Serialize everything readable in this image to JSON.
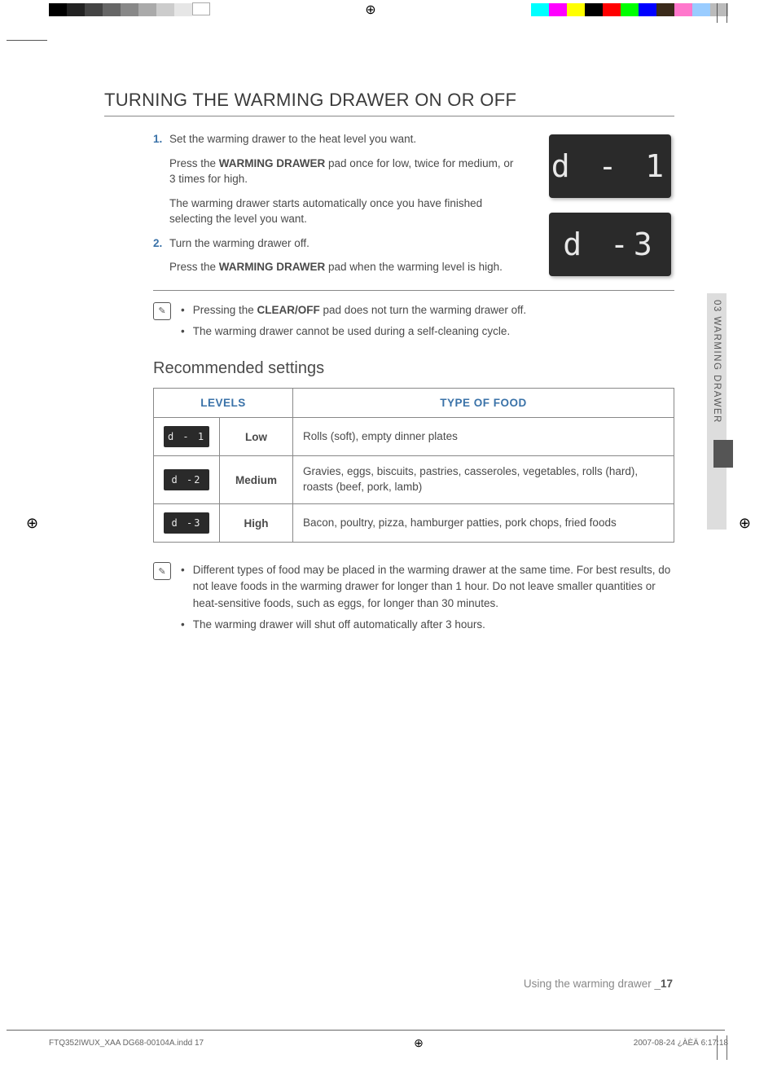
{
  "heading": "TURNING THE WARMING DRAWER ON OR OFF",
  "steps": [
    {
      "num": "1.",
      "text": "Set the warming drawer to the heat level you want.",
      "subs": [
        {
          "pre": "Press the ",
          "bold": "WARMING DRAWER",
          "post": " pad once for low, twice for medium, or 3 times for high."
        },
        {
          "plain": "The warming drawer starts automatically once you have finished selecting the level you want."
        }
      ]
    },
    {
      "num": "2.",
      "text": "Turn the warming drawer off.",
      "subs": [
        {
          "pre": "Press the ",
          "bold": "WARMING DRAWER",
          "post": " pad when the warming level is high."
        }
      ]
    }
  ],
  "displays": {
    "d1": "d - 1",
    "d3": "d -3"
  },
  "notes1": [
    {
      "pre": "Pressing the ",
      "bold": "CLEAR/OFF",
      "post": " pad does not turn the warming drawer off."
    },
    {
      "plain": "The warming drawer cannot be used during a self-cleaning cycle."
    }
  ],
  "subheading": "Recommended settings",
  "table": {
    "head": {
      "levels": "LEVELS",
      "type": "TYPE OF FOOD"
    },
    "rows": [
      {
        "disp": "d - 1",
        "level": "Low",
        "food": "Rolls (soft), empty dinner plates"
      },
      {
        "disp": "d -2",
        "level": "Medium",
        "food": "Gravies, eggs, biscuits, pastries, casseroles, vegetables, rolls (hard), roasts (beef, pork, lamb)"
      },
      {
        "disp": "d -3",
        "level": "High",
        "food": "Bacon, poultry, pizza, hamburger patties, pork chops, fried foods"
      }
    ]
  },
  "notes2": [
    {
      "plain": "Different types of food may be placed in the warming drawer at the same time. For best results, do not leave foods in the warming drawer for longer than 1 hour. Do not leave smaller quantities or heat-sensitive foods, such as eggs, for longer than 30 minutes."
    },
    {
      "plain": "The warming drawer will shut off automatically after 3 hours."
    }
  ],
  "sideTab": "03   WARMING DRAWER",
  "footer": {
    "label": "Using the warming drawer _",
    "page": "17"
  },
  "imprint": {
    "left": "FTQ352IWUX_XAA DG68-00104A.indd   17",
    "right": "2007-08-24   ¿ÀÈÄ 6:17:18"
  },
  "chart_data": {
    "type": "table",
    "title": "Recommended settings",
    "columns": [
      "LEVELS (display)",
      "LEVELS (label)",
      "TYPE OF FOOD"
    ],
    "rows": [
      [
        "d - 1",
        "Low",
        "Rolls (soft), empty dinner plates"
      ],
      [
        "d -2",
        "Medium",
        "Gravies, eggs, biscuits, pastries, casseroles, vegetables, rolls (hard), roasts (beef, pork, lamb)"
      ],
      [
        "d -3",
        "High",
        "Bacon, poultry, pizza, hamburger patties, pork chops, fried foods"
      ]
    ]
  },
  "colors": {
    "accent": "#3a72a8",
    "display_bg": "#2a2a2a",
    "display_fg": "#e8e8e8"
  }
}
